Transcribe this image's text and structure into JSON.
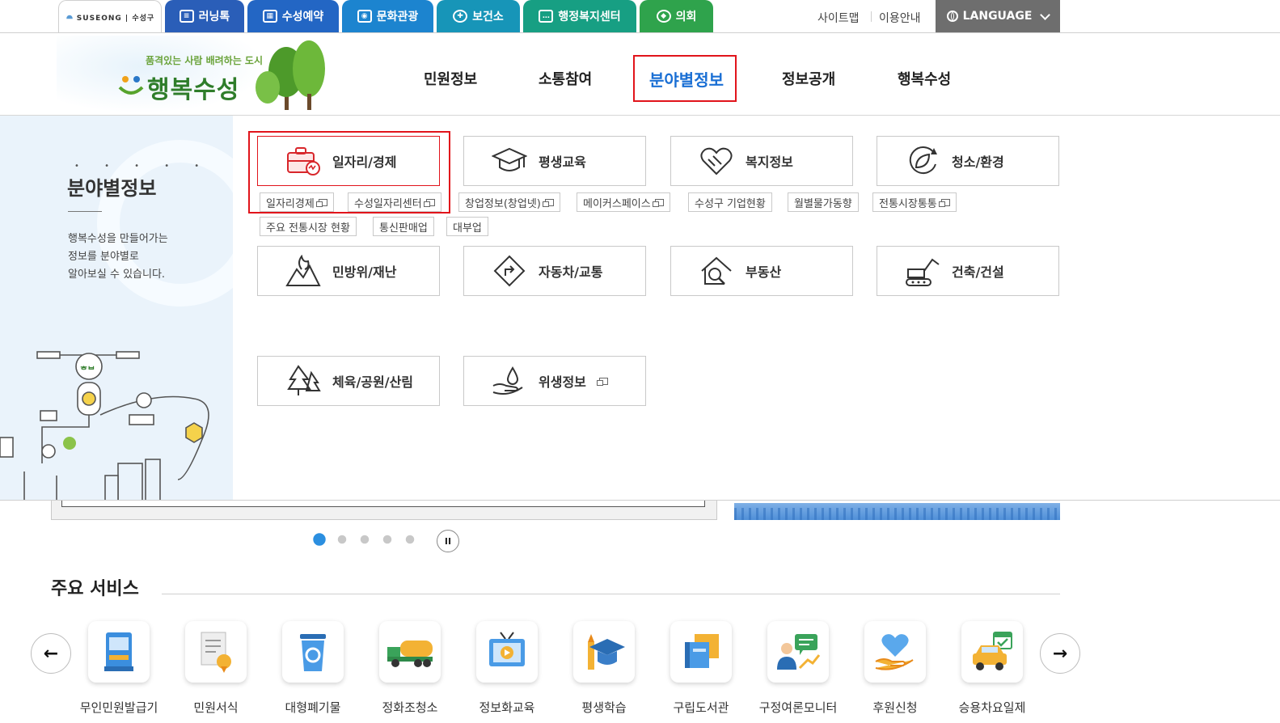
{
  "top_bar": {
    "logo_text": "SUSEONG | 수성구",
    "tabs": [
      {
        "label": "러닝톡",
        "color": "#2a5eb8"
      },
      {
        "label": "수성예약",
        "color": "#2366c4"
      },
      {
        "label": "문화관광",
        "color": "#1c84cf"
      },
      {
        "label": "보건소",
        "color": "#1795b8"
      },
      {
        "label": "행정복지센터",
        "color": "#179f83"
      },
      {
        "label": "의회",
        "color": "#2fa34c"
      }
    ],
    "sitemap": "사이트맵",
    "guide": "이용안내",
    "language": "LANGUAGE"
  },
  "brand": {
    "slogan": "품격있는 사람 배려하는 도시",
    "name": "행복수성"
  },
  "gnb": {
    "items": [
      "민원정보",
      "소통참여",
      "분야별정보",
      "정보공개",
      "행복수성"
    ],
    "active_index": 2,
    "active_color": "#1a6fd4"
  },
  "side_panel": {
    "dots": "• • • • •",
    "title": "분야별정보",
    "description_lines": [
      "행복수성을 만들어가는",
      "정보를 분야별로",
      "알아보실 수 있습니다."
    ]
  },
  "categories": [
    {
      "label": "일자리/경제",
      "icon": "briefcase-icon",
      "highlighted": true
    },
    {
      "label": "평생교육",
      "icon": "graduation-cap-icon"
    },
    {
      "label": "복지정보",
      "icon": "heart-hands-icon"
    },
    {
      "label": "청소/환경",
      "icon": "leaf-cycle-icon"
    },
    {
      "label": "민방위/재난",
      "icon": "fire-mountain-icon"
    },
    {
      "label": "자동차/교통",
      "icon": "road-sign-icon"
    },
    {
      "label": "부동산",
      "icon": "house-search-icon"
    },
    {
      "label": "건축/건설",
      "icon": "excavator-icon"
    },
    {
      "label": "체육/공원/산림",
      "icon": "pine-tree-icon"
    },
    {
      "label": "위생정보",
      "icon": "water-hand-icon",
      "new_window": true
    }
  ],
  "sub_links": [
    {
      "label": "일자리경제",
      "new_window": true
    },
    {
      "label": "수성일자리센터",
      "new_window": true
    },
    {
      "label": "창업정보(창업넷)",
      "new_window": true
    },
    {
      "label": "메이커스페이스",
      "new_window": true
    },
    {
      "label": "수성구 기업현황",
      "new_window": false
    },
    {
      "label": "월별물가동향",
      "new_window": false
    },
    {
      "label": "전통시장통통",
      "new_window": true
    },
    {
      "label": "주요 전통시장 현황",
      "new_window": false
    },
    {
      "label": "통신판매업",
      "new_window": false
    },
    {
      "label": "대부업",
      "new_window": false
    }
  ],
  "slider": {
    "dot_count": 5,
    "active_dot": 0,
    "pause_symbol": "II"
  },
  "services": {
    "title": "주요 서비스",
    "prev_symbol": "←",
    "next_symbol": "→",
    "items": [
      {
        "label": "무인민원발급기",
        "icon": "kiosk-icon"
      },
      {
        "label": "민원서식",
        "icon": "document-award-icon"
      },
      {
        "label": "대형폐기물",
        "icon": "recycle-bin-icon"
      },
      {
        "label": "정화조청소",
        "icon": "tank-truck-icon"
      },
      {
        "label": "정보화교육",
        "icon": "monitor-play-icon"
      },
      {
        "label": "평생학습",
        "icon": "graduation-cap-icon"
      },
      {
        "label": "구립도서관",
        "icon": "books-icon"
      },
      {
        "label": "구정여론모니터",
        "icon": "speech-person-icon"
      },
      {
        "label": "후원신청",
        "icon": "heart-hand-icon"
      },
      {
        "label": "승용차요일제",
        "icon": "car-calendar-icon"
      }
    ]
  },
  "colors": {
    "highlight_red": "#e1141b",
    "accent_blue": "#2b8fe0"
  }
}
